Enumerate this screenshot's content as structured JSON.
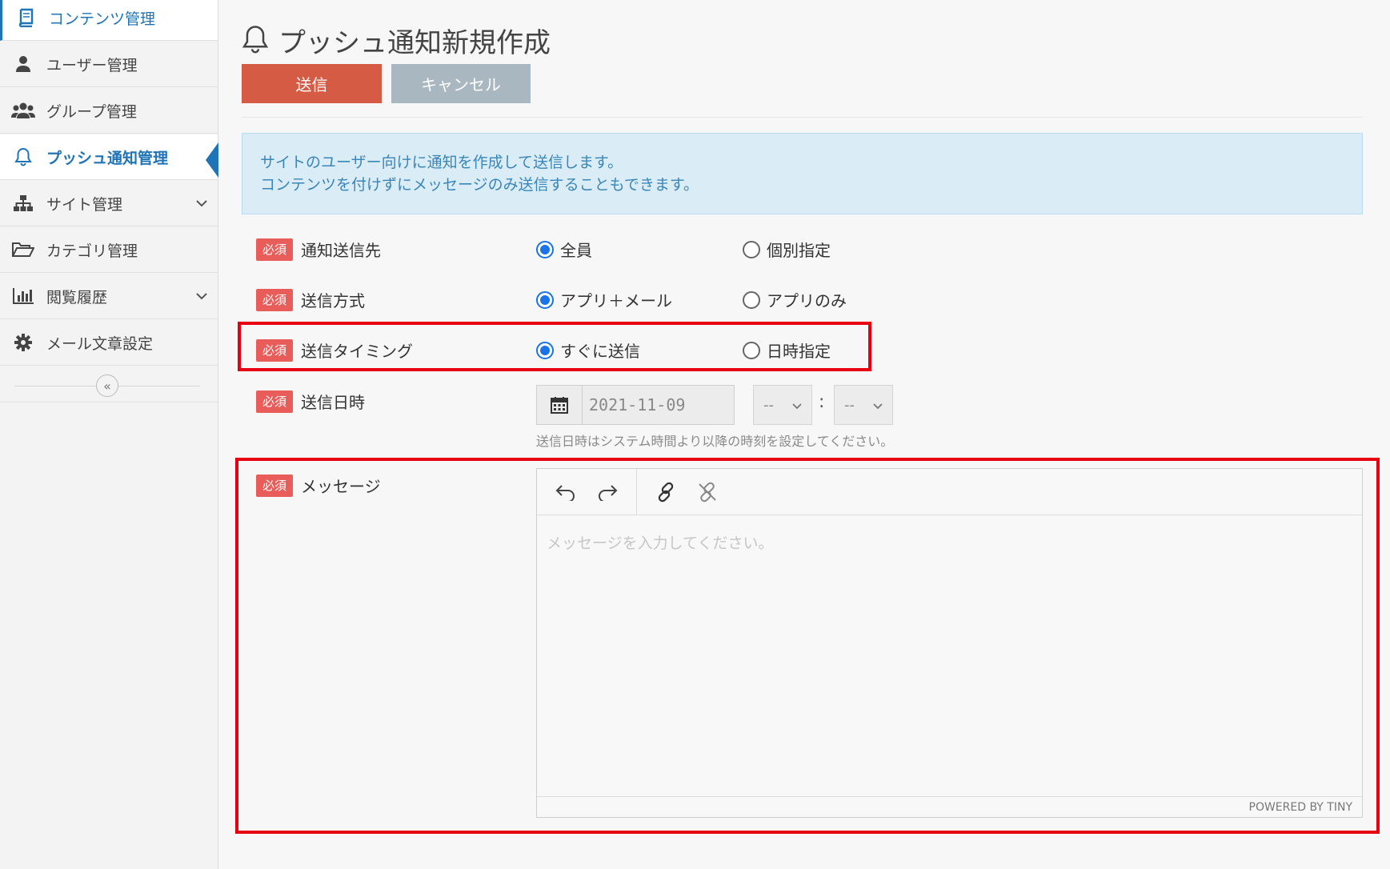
{
  "sidebar": {
    "items": [
      {
        "label": "コンテンツ管理",
        "icon": "book-icon"
      },
      {
        "label": "ユーザー管理",
        "icon": "user-icon"
      },
      {
        "label": "グループ管理",
        "icon": "users-icon"
      },
      {
        "label": "プッシュ通知管理",
        "icon": "bell-icon"
      },
      {
        "label": "サイト管理",
        "icon": "sitemap-icon"
      },
      {
        "label": "カテゴリ管理",
        "icon": "folder-open-icon"
      },
      {
        "label": "閲覧履歴",
        "icon": "bar-chart-icon"
      },
      {
        "label": "メール文章設定",
        "icon": "gear-icon"
      }
    ],
    "collapse_glyph": "«"
  },
  "header": {
    "title": "プッシュ通知新規作成",
    "send_label": "送信",
    "cancel_label": "キャンセル"
  },
  "info": {
    "line1": "サイトのユーザー向けに通知を作成して送信します。",
    "line2": "コンテンツを付けずにメッセージのみ送信することもできます。"
  },
  "form": {
    "required_badge": "必須",
    "recipient": {
      "label": "通知送信先",
      "options": [
        "全員",
        "個別指定"
      ],
      "selected": "全員"
    },
    "method": {
      "label": "送信方式",
      "options": [
        "アプリ＋メール",
        "アプリのみ"
      ],
      "selected": "アプリ＋メール"
    },
    "timing": {
      "label": "送信タイミング",
      "options": [
        "すぐに送信",
        "日時指定"
      ],
      "selected": "すぐに送信"
    },
    "datetime": {
      "label": "送信日時",
      "date_value": "2021-11-09",
      "hour_value": "--",
      "minute_value": "--",
      "separator": ":",
      "hint": "送信日時はシステム時間より以降の時刻を設定してください。"
    },
    "message": {
      "label": "メッセージ",
      "placeholder": "メッセージを入力してください。",
      "powered_by": "POWERED BY TINY"
    }
  },
  "colors": {
    "accent": "#1f73b7",
    "send": "#d55b44",
    "cancel": "#a9b7c0",
    "required": "#e85c5a",
    "highlight": "#e60012"
  }
}
